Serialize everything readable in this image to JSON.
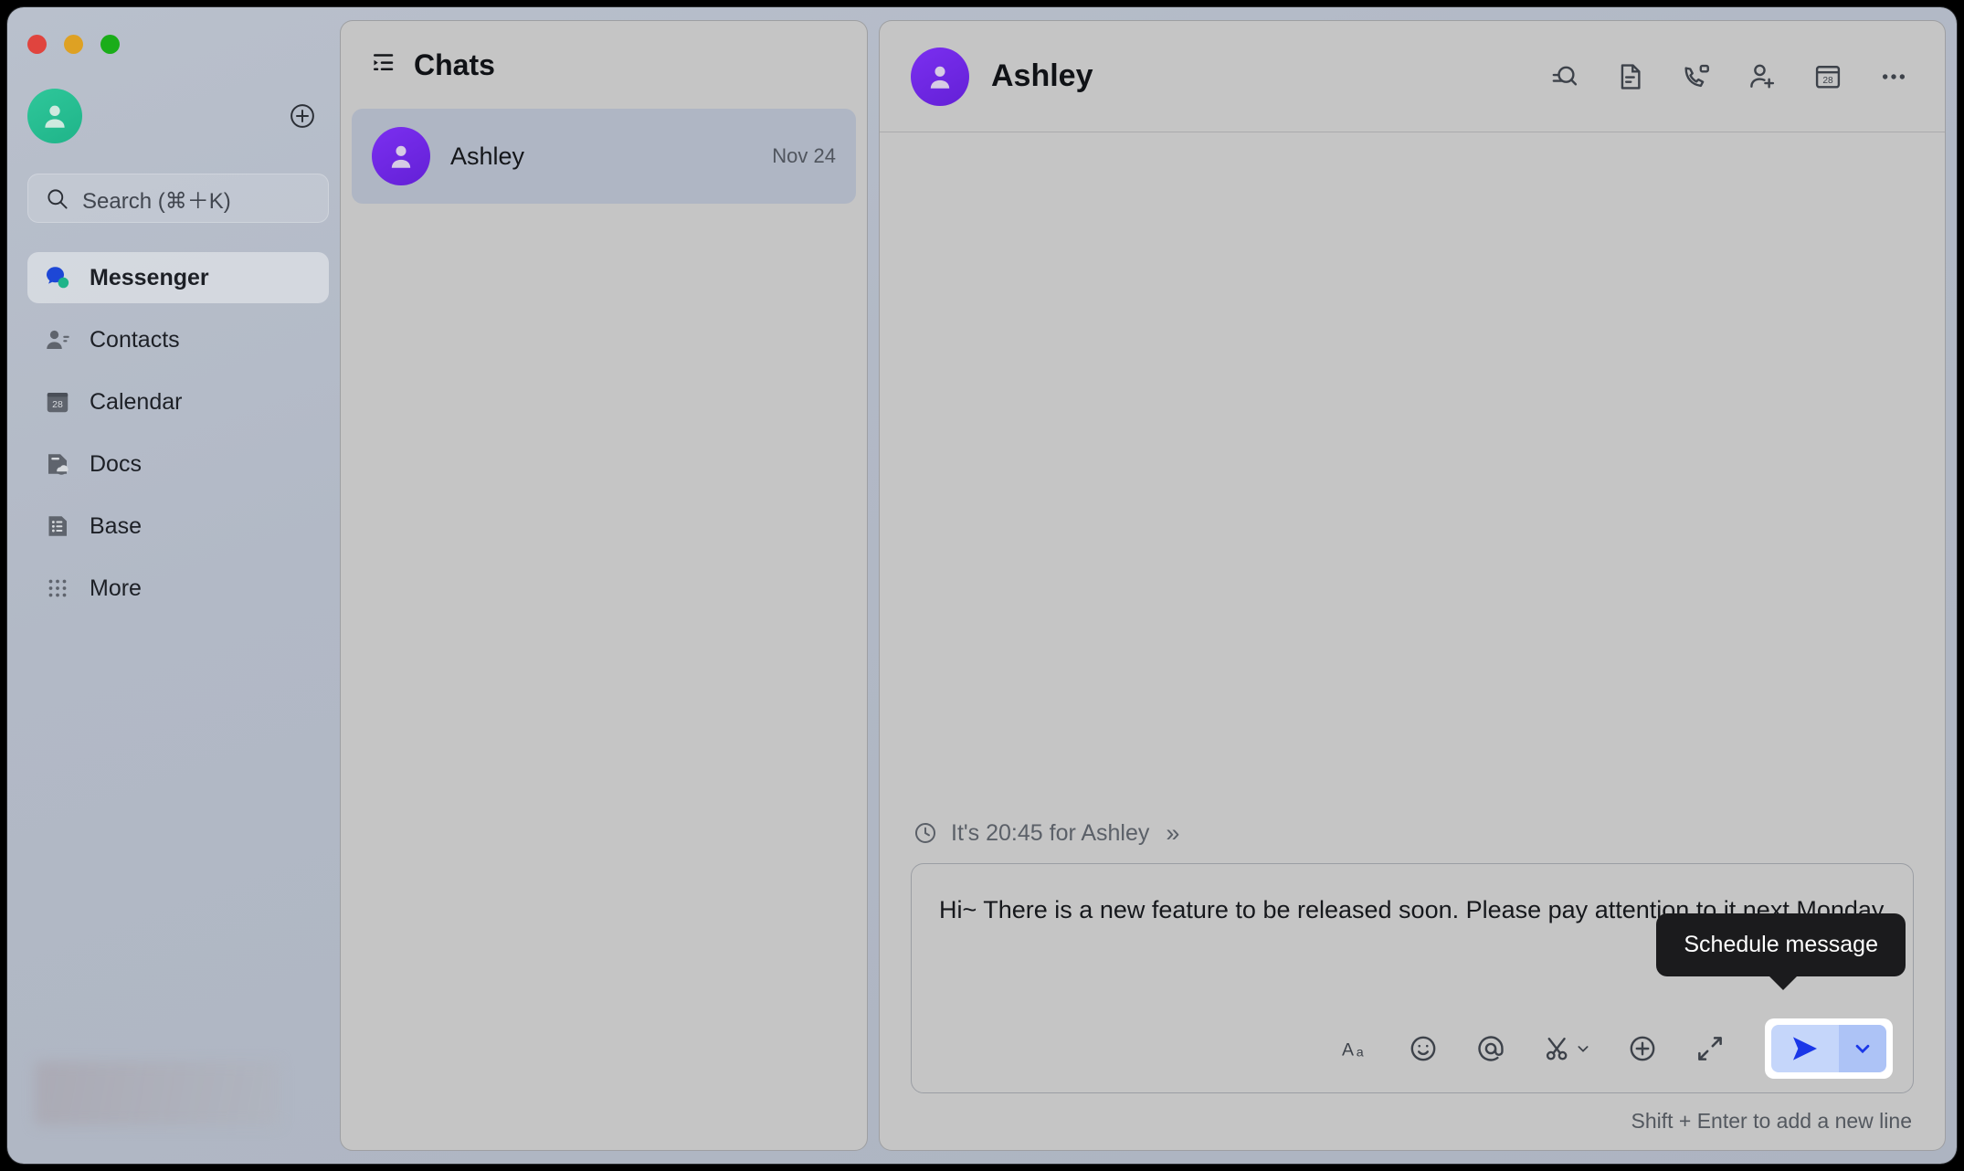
{
  "window": {
    "traffic_lights": [
      {
        "name": "close",
        "color": "#e0443e"
      },
      {
        "name": "minimize",
        "color": "#dea123"
      },
      {
        "name": "maximize",
        "color": "#1aad19"
      }
    ]
  },
  "sidebar": {
    "avatar_icon": "person-avatar-icon",
    "add_icon": "plus-circle-icon",
    "search": {
      "icon": "search-icon",
      "label": "Search (⌘＋K)"
    },
    "items": [
      {
        "label": "Messenger",
        "icon": "messenger-icon",
        "active": true
      },
      {
        "label": "Contacts",
        "icon": "contacts-icon",
        "active": false
      },
      {
        "label": "Calendar",
        "icon": "calendar-icon",
        "active": false
      },
      {
        "label": "Docs",
        "icon": "docs-icon",
        "active": false
      },
      {
        "label": "Base",
        "icon": "base-icon",
        "active": false
      },
      {
        "label": "More",
        "icon": "more-grid-icon",
        "active": false
      }
    ],
    "calendar_day": "28"
  },
  "chat_list": {
    "title": "Chats",
    "title_icon": "chat-list-icon",
    "items": [
      {
        "name": "Ashley",
        "date": "Nov 24",
        "avatar_color": "#6f27e6",
        "selected": true
      }
    ]
  },
  "conversation": {
    "title": "Ashley",
    "avatar_color": "#6f27e6",
    "actions": [
      {
        "name": "search-in-chat-icon",
        "label": "Search in chat"
      },
      {
        "name": "document-icon",
        "label": "Documents"
      },
      {
        "name": "video-call-icon",
        "label": "Video call"
      },
      {
        "name": "add-member-icon",
        "label": "Add member"
      },
      {
        "name": "calendar-icon",
        "label": "Calendar",
        "day": "28"
      },
      {
        "name": "more-horizontal-icon",
        "label": "More"
      }
    ],
    "time_hint": {
      "icon": "clock-icon",
      "text": "It's 20:45 for Ashley",
      "chevron": "»"
    },
    "composer": {
      "message": "Hi~ There is a new feature to be released soon. Please pay attention to it next Monday",
      "tools": [
        {
          "name": "text-format-icon",
          "glyph": "Aa"
        },
        {
          "name": "emoji-icon"
        },
        {
          "name": "mention-icon"
        },
        {
          "name": "scissors-icon"
        },
        {
          "name": "add-attachment-icon"
        },
        {
          "name": "expand-icon"
        }
      ],
      "send": {
        "name": "send-button",
        "dropdown_name": "send-options-chevron",
        "color": "#1a37e8",
        "bg": "#c5d6fa",
        "dropdown_bg": "#adc3f6"
      },
      "tooltip": "Schedule message",
      "hint": "Shift + Enter to add a new line"
    }
  }
}
